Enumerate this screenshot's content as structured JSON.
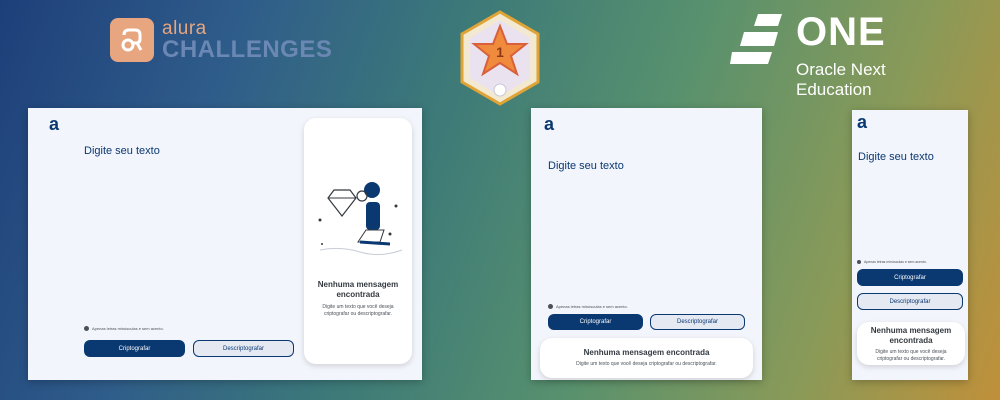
{
  "header": {
    "alura_small": "alura",
    "alura_big": "CHALLENGES",
    "one_title": "ONE",
    "one_sub_line1": "Oracle Next",
    "one_sub_line2": "Education",
    "badge_number": "1"
  },
  "app": {
    "brand_letter": "a",
    "heading": "Digite seu texto",
    "hint": "Apenas letras minúsculas e sem acento.",
    "encrypt_label": "Criptografar",
    "decrypt_label": "Descriptografar",
    "empty_title": "Nenhuma mensagem encontrada",
    "empty_title_line1": "Nenhuma mensagem",
    "empty_title_line2": "encontrada",
    "empty_text": "Digite um texto que você deseja criptografar ou descriptografar.",
    "empty_text_line1": "Digite um texto que você deseja",
    "empty_text_line2": "criptografar ou descriptografar."
  },
  "colors": {
    "primary": "#0a3871",
    "background": "#f3f5fc",
    "alura_accent": "#e7a67f"
  }
}
